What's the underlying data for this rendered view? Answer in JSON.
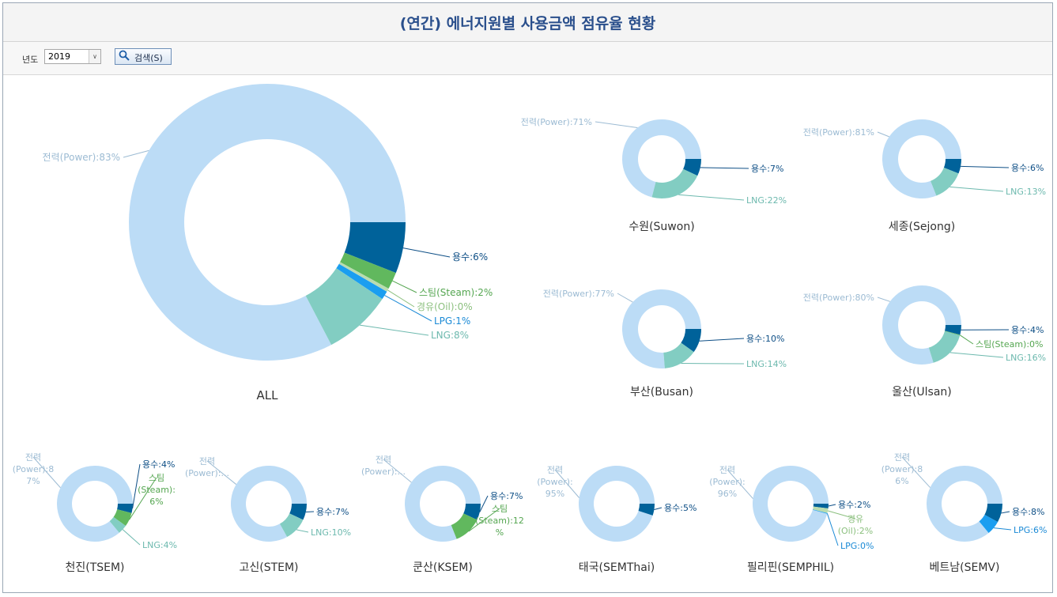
{
  "window": {
    "title": "(연간) 에너지원별 사용금액 점유율 현황"
  },
  "toolbar": {
    "year_label": "년도",
    "year_value": "2019",
    "search_label": "검색(S)"
  },
  "icons": {
    "search": "search-icon",
    "dropdown": "chevron-down-icon"
  },
  "colors": {
    "title": "#2a4f8c",
    "power": "#bcdcf6",
    "water": "#00629a",
    "steam": "#61b85e",
    "oil": "#b9dcb0",
    "lpg": "#1b9ef0",
    "lng": "#82cdc2",
    "chart_title": "#333333"
  },
  "chart_data": [
    {
      "type": "pie",
      "title": "ALL",
      "donut": true,
      "slices": [
        {
          "label": "전력(Power):83%",
          "name": "전력(Power)",
          "value": 83,
          "color": "#bcdcf6",
          "text_color": "#9cbbd3"
        },
        {
          "label": "용수:6%",
          "name": "용수",
          "value": 6,
          "color": "#00629a",
          "text_color": "#0e4f86"
        },
        {
          "label": "스팀(Steam):2%",
          "name": "스팀(Steam)",
          "value": 2,
          "color": "#61b85e",
          "text_color": "#55a651"
        },
        {
          "label": "경유(Oil):0%",
          "name": "경유(Oil)",
          "value": 0.4,
          "color": "#b9dcb0",
          "text_color": "#8cc07f"
        },
        {
          "label": "LPG:1%",
          "name": "LPG",
          "value": 1,
          "color": "#1b9ef0",
          "text_color": "#1b8ad6"
        },
        {
          "label": "LNG:8%",
          "name": "LNG",
          "value": 8,
          "color": "#82cdc2",
          "text_color": "#6db9ae"
        }
      ]
    },
    {
      "type": "pie",
      "title": "수원(Suwon)",
      "donut": true,
      "slices": [
        {
          "label": "전력(Power):71%",
          "name": "전력(Power)",
          "value": 71,
          "color": "#bcdcf6",
          "text_color": "#9cbbd3"
        },
        {
          "label": "용수:7%",
          "name": "용수",
          "value": 7,
          "color": "#00629a",
          "text_color": "#0e4f86"
        },
        {
          "label": "LNG:22%",
          "name": "LNG",
          "value": 22,
          "color": "#82cdc2",
          "text_color": "#6db9ae"
        }
      ]
    },
    {
      "type": "pie",
      "title": "세종(Sejong)",
      "donut": true,
      "slices": [
        {
          "label": "전력(Power):81%",
          "name": "전력(Power)",
          "value": 81,
          "color": "#bcdcf6",
          "text_color": "#9cbbd3"
        },
        {
          "label": "용수:6%",
          "name": "용수",
          "value": 6,
          "color": "#00629a",
          "text_color": "#0e4f86"
        },
        {
          "label": "LNG:13%",
          "name": "LNG",
          "value": 13,
          "color": "#82cdc2",
          "text_color": "#6db9ae"
        }
      ]
    },
    {
      "type": "pie",
      "title": "부산(Busan)",
      "donut": true,
      "slices": [
        {
          "label": "전력(Power):77%",
          "name": "전력(Power)",
          "value": 77,
          "color": "#bcdcf6",
          "text_color": "#9cbbd3"
        },
        {
          "label": "용수:10%",
          "name": "용수",
          "value": 10,
          "color": "#00629a",
          "text_color": "#0e4f86"
        },
        {
          "label": "LNG:14%",
          "name": "LNG",
          "value": 14,
          "color": "#82cdc2",
          "text_color": "#6db9ae"
        }
      ]
    },
    {
      "type": "pie",
      "title": "울산(Ulsan)",
      "donut": true,
      "slices": [
        {
          "label": "전력(Power):80%",
          "name": "전력(Power)",
          "value": 80,
          "color": "#bcdcf6",
          "text_color": "#9cbbd3"
        },
        {
          "label": "용수:4%",
          "name": "용수",
          "value": 4,
          "color": "#00629a",
          "text_color": "#0e4f86"
        },
        {
          "label": "스팀(Steam):0%",
          "name": "스팀(Steam)",
          "value": 0.3,
          "color": "#61b85e",
          "text_color": "#55a651"
        },
        {
          "label": "LNG:16%",
          "name": "LNG",
          "value": 16,
          "color": "#82cdc2",
          "text_color": "#6db9ae"
        }
      ]
    },
    {
      "type": "pie",
      "title": "천진(TSEM)",
      "donut": true,
      "slices": [
        {
          "label": "전력(Power):87%",
          "name": "전력(Power)",
          "value": 87,
          "color": "#bcdcf6",
          "text_color": "#9cbbd3",
          "label_lines": [
            "전력",
            "(Power):8",
            "7%"
          ]
        },
        {
          "label": "용수:4%",
          "name": "용수",
          "value": 4,
          "color": "#00629a",
          "text_color": "#0e4f86"
        },
        {
          "label": "스팀(Steam):6%",
          "name": "스팀(Steam)",
          "value": 6,
          "color": "#61b85e",
          "text_color": "#55a651",
          "label_lines": [
            "스팀",
            "(Steam):",
            "6%"
          ]
        },
        {
          "label": "LNG:4%",
          "name": "LNG",
          "value": 4,
          "color": "#82cdc2",
          "text_color": "#6db9ae"
        }
      ]
    },
    {
      "type": "pie",
      "title": "고신(STEM)",
      "donut": true,
      "slices": [
        {
          "label": "전력(Power):...",
          "name": "전력(Power)",
          "value": 83,
          "color": "#bcdcf6",
          "text_color": "#9cbbd3",
          "label_lines": [
            "전력",
            "(Power):..."
          ]
        },
        {
          "label": "용수:7%",
          "name": "용수",
          "value": 7,
          "color": "#00629a",
          "text_color": "#0e4f86"
        },
        {
          "label": "LNG:10%",
          "name": "LNG",
          "value": 10,
          "color": "#82cdc2",
          "text_color": "#6db9ae"
        }
      ]
    },
    {
      "type": "pie",
      "title": "쿤산(KSEM)",
      "donut": true,
      "slices": [
        {
          "label": "전력(Power):...",
          "name": "전력(Power)",
          "value": 81,
          "color": "#bcdcf6",
          "text_color": "#9cbbd3",
          "label_lines": [
            "전력",
            "(Power):..."
          ]
        },
        {
          "label": "용수:7%",
          "name": "용수",
          "value": 7,
          "color": "#00629a",
          "text_color": "#0e4f86"
        },
        {
          "label": "스팀(Steam):12%",
          "name": "스팀(Steam)",
          "value": 12,
          "color": "#61b85e",
          "text_color": "#55a651",
          "label_lines": [
            "스팀",
            "(Steam):12",
            "%"
          ]
        }
      ]
    },
    {
      "type": "pie",
      "title": "태국(SEMThai)",
      "donut": true,
      "slices": [
        {
          "label": "전력(Power):95%",
          "name": "전력(Power)",
          "value": 95,
          "color": "#bcdcf6",
          "text_color": "#9cbbd3",
          "label_lines": [
            "전력",
            "(Power):",
            "95%"
          ]
        },
        {
          "label": "용수:5%",
          "name": "용수",
          "value": 5,
          "color": "#00629a",
          "text_color": "#0e4f86"
        }
      ]
    },
    {
      "type": "pie",
      "title": "필리핀(SEMPHIL)",
      "donut": true,
      "slices": [
        {
          "label": "전력(Power):96%",
          "name": "전력(Power)",
          "value": 96,
          "color": "#bcdcf6",
          "text_color": "#9cbbd3",
          "label_lines": [
            "전력",
            "(Power):",
            "96%"
          ]
        },
        {
          "label": "용수:2%",
          "name": "용수",
          "value": 2,
          "color": "#00629a",
          "text_color": "#0e4f86"
        },
        {
          "label": "경유(Oil):2%",
          "name": "경유(Oil)",
          "value": 2,
          "color": "#b9dcb0",
          "text_color": "#8cc07f",
          "label_lines": [
            "경유",
            "(Oil):2%"
          ]
        },
        {
          "label": "LPG:0%",
          "name": "LPG",
          "value": 0.3,
          "color": "#1b9ef0",
          "text_color": "#1b8ad6"
        }
      ]
    },
    {
      "type": "pie",
      "title": "베트남(SEMV)",
      "donut": true,
      "slices": [
        {
          "label": "전력(Power):86%",
          "name": "전력(Power)",
          "value": 86,
          "color": "#bcdcf6",
          "text_color": "#9cbbd3",
          "label_lines": [
            "전력",
            "(Power):8",
            "6%"
          ]
        },
        {
          "label": "용수:8%",
          "name": "용수",
          "value": 8,
          "color": "#00629a",
          "text_color": "#0e4f86"
        },
        {
          "label": "LPG:6%",
          "name": "LPG",
          "value": 6,
          "color": "#1b9ef0",
          "text_color": "#1b8ad6"
        }
      ]
    }
  ]
}
